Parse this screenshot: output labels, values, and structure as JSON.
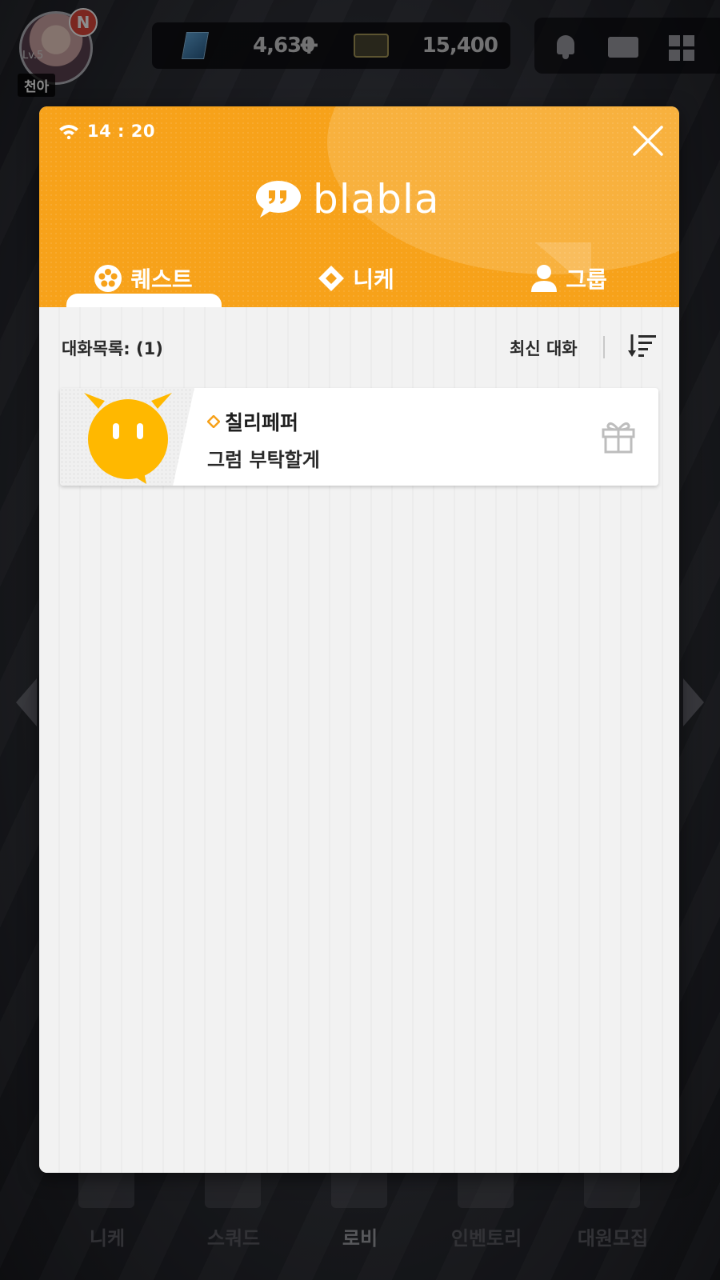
{
  "player": {
    "name": "천아",
    "level": "Lv.5",
    "badge": "N"
  },
  "currency": {
    "gems": "4,630",
    "gems_plus": "+",
    "credits": "15,400"
  },
  "bottom_nav": [
    "니케",
    "스쿼드",
    "로비",
    "인벤토리",
    "대원모집"
  ],
  "modal": {
    "status_time": "14 : 20",
    "logo_text": "blabla",
    "tabs": [
      {
        "label": "퀘스트",
        "icon": "quest-icon",
        "active": true
      },
      {
        "label": "니케",
        "icon": "diamond-icon",
        "active": false
      },
      {
        "label": "그룹",
        "icon": "person-icon",
        "active": false
      }
    ],
    "list_count": "대화목록: (1)",
    "sort_label": "최신 대화",
    "chats": [
      {
        "name": "칠리페퍼",
        "preview": "그럼 부탁할게",
        "action_icon": "gift-icon"
      }
    ]
  },
  "colors": {
    "accent": "#f7a21a",
    "body_bg": "#f2f2f2",
    "avatar_yellow": "#ffb800"
  }
}
